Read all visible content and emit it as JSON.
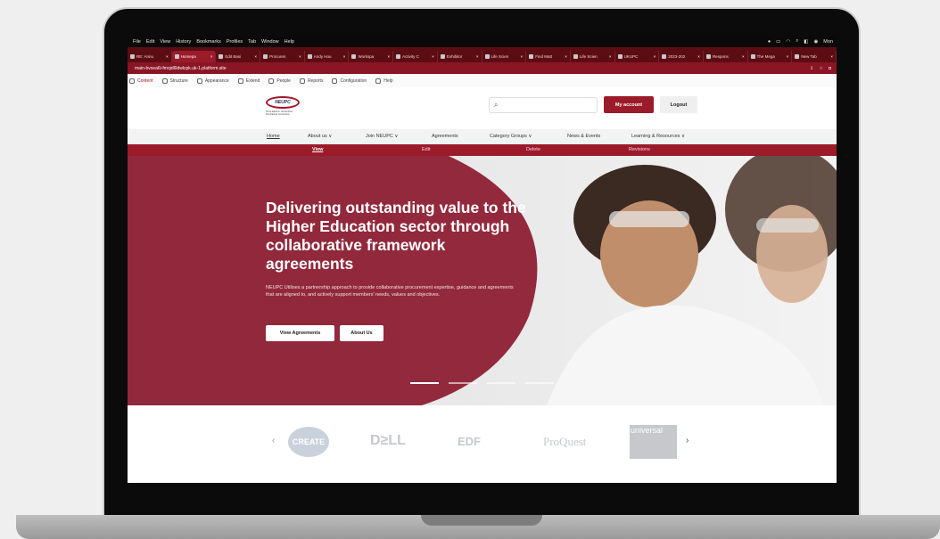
{
  "menubar": {
    "items": [
      "File",
      "Edit",
      "View",
      "History",
      "Bookmarks",
      "Profiles",
      "Tab",
      "Window",
      "Help"
    ],
    "right_label": "Mon"
  },
  "tabs": [
    {
      "label": "RE: Annu"
    },
    {
      "label": "Homepa",
      "active": true
    },
    {
      "label": "Edit Basi"
    },
    {
      "label": "Procuren"
    },
    {
      "label": "Andy Hou"
    },
    {
      "label": "Workspa"
    },
    {
      "label": "Activity C"
    },
    {
      "label": "Exhibitor"
    },
    {
      "label": "Life Scien"
    },
    {
      "label": "Find Matt"
    },
    {
      "label": "Life Scien"
    },
    {
      "label": "UKUPC"
    },
    {
      "label": "2023-202"
    },
    {
      "label": "Respons"
    },
    {
      "label": "The Mega"
    },
    {
      "label": "New Tab"
    }
  ],
  "address": {
    "url": "main-bvxea6i-fmqid6ldwlcpk.uk-1.platform.site"
  },
  "admin_toolbar": [
    "Content",
    "Structure",
    "Appearance",
    "Extend",
    "People",
    "Reports",
    "Configuration",
    "Help"
  ],
  "header": {
    "logo_text": "NEUPC",
    "logo_sub": "North Eastern Universities Purchasing Consortium",
    "my_account": "My account",
    "logout": "Logout"
  },
  "nav": [
    {
      "label": "Home"
    },
    {
      "label": "About us ∨"
    },
    {
      "label": "Join NEUPC ∨"
    },
    {
      "label": "Agreements"
    },
    {
      "label": "Category Groups ∨"
    },
    {
      "label": "News & Events"
    },
    {
      "label": "Learning & Resources ∨"
    }
  ],
  "tasks": [
    "View",
    "Edit",
    "Delete",
    "Revisions"
  ],
  "hero": {
    "title": "Delivering outstanding value to the Higher Education sector through collaborative framework agreements",
    "text": "NEUPC Utilises a partnership approach to provide collaborative procurement expertise, guidance and agreements that are aligned to, and actively support members' needs, values and objectives.",
    "btn_agreements": "View Agreements",
    "btn_about": "About Us"
  },
  "partners": [
    "CREATE",
    "D≥LL",
    "EDF",
    "ProQuest",
    "universal"
  ],
  "colors": {
    "brand": "#9b1b2a",
    "tabbar": "#5c0d14",
    "address": "#8a1524"
  }
}
